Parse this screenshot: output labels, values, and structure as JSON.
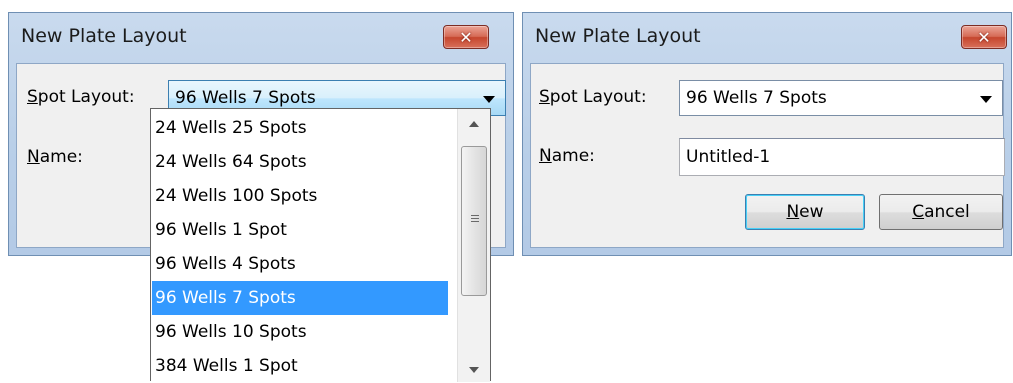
{
  "left_dialog": {
    "title": "New Plate Layout",
    "close_label": "✕",
    "spot_layout_label_u": "S",
    "spot_layout_label_rest": "pot Layout:",
    "spot_layout_value": "96 Wells 7 Spots",
    "name_label_u": "N",
    "name_label_rest": "ame:",
    "dropdown_options": [
      "24 Wells 25 Spots",
      "24 Wells 64 Spots",
      "24 Wells 100 Spots",
      "96 Wells 1 Spot",
      "96 Wells 4 Spots",
      "96 Wells 7 Spots",
      "96 Wells 10 Spots",
      "384 Wells 1 Spot"
    ],
    "selected_option": "96 Wells 7 Spots"
  },
  "right_dialog": {
    "title": "New Plate Layout",
    "close_label": "✕",
    "spot_layout_label_u": "S",
    "spot_layout_label_rest": "pot Layout:",
    "spot_layout_value": "96 Wells 7 Spots",
    "name_label_u": "N",
    "name_label_rest": "ame:",
    "name_value": "Untitled-1",
    "new_button_u": "N",
    "new_button_rest": "ew",
    "cancel_button_u": "C",
    "cancel_button_rest": "ancel"
  },
  "icons": {
    "close": "close-icon",
    "combo_arrow": "chevron-down-icon",
    "scroll_up": "scroll-up-arrow-icon",
    "scroll_down": "scroll-down-arrow-icon"
  },
  "colors": {
    "selection": "#3399ff",
    "close_button": "#c5452d",
    "title_bar": "#b9cfe8"
  }
}
